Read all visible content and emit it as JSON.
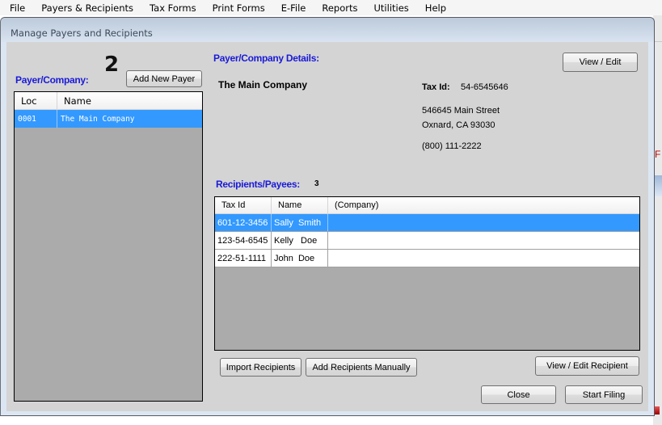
{
  "menu": [
    "File",
    "Payers & Recipients",
    "Tax Forms",
    "Print Forms",
    "E-File",
    "Reports",
    "Utilities",
    "Help"
  ],
  "window": {
    "title": "Manage Payers and Recipients"
  },
  "annotations": {
    "payer": "2",
    "recipients": "3"
  },
  "payer_panel": {
    "label": "Payer/Company:",
    "add_button": "Add New Payer",
    "columns": [
      "Loc",
      "Name"
    ],
    "rows": [
      {
        "loc": "0001",
        "name": "The Main Company",
        "selected": true
      }
    ]
  },
  "details": {
    "label": "Payer/Company Details:",
    "view_edit_button": "View / Edit",
    "company_name": "The Main Company",
    "tax_id_label": "Tax Id:",
    "tax_id": "54-6545646",
    "address_line1": "546645 Main Street",
    "address_line2": "Oxnard, CA  93030",
    "phone": "(800) 111-2222"
  },
  "recipients": {
    "label": "Recipients/Payees:",
    "count": "3",
    "columns": [
      "Tax Id",
      "Name",
      "(Company)"
    ],
    "rows": [
      {
        "tax_id": "601-12-3456",
        "name": "Sally  Smith",
        "company": "",
        "selected": true
      },
      {
        "tax_id": "123-54-6545",
        "name": "Kelly   Doe",
        "company": "",
        "selected": false
      },
      {
        "tax_id": "222-51-1111",
        "name": "John  Doe",
        "company": "",
        "selected": false
      }
    ],
    "import_button": "Import Recipients",
    "add_manual_button": "Add Recipients Manually",
    "view_edit_button": "View / Edit Recipient"
  },
  "footer": {
    "close_button": "Close",
    "start_button": "Start Filing"
  },
  "background": {
    "partial_letter": "F"
  }
}
